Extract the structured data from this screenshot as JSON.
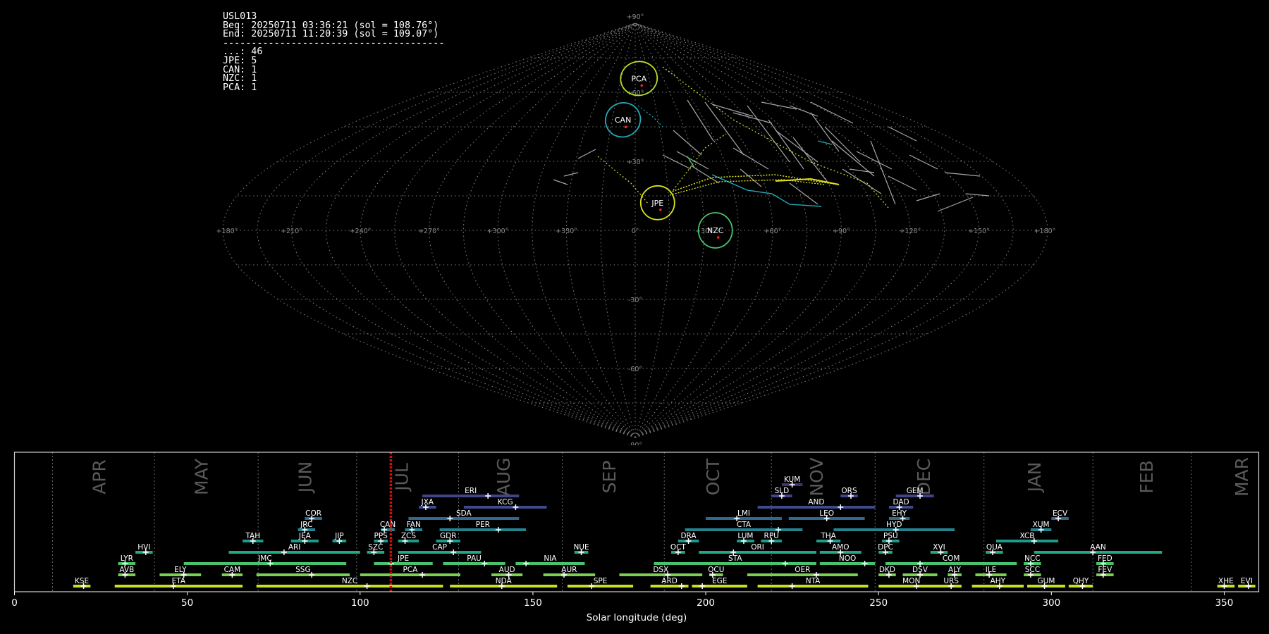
{
  "info": {
    "lines": [
      "USL013",
      "Beg: 20250711 03:36:21 (sol = 108.76°)",
      "End: 20250711 11:20:39 (sol = 109.07°)",
      "---------------------------------------",
      "...: 46",
      "JPE: 5",
      "CAN: 1",
      "NZC: 1",
      "PCA: 1"
    ]
  },
  "sky_map": {
    "projection": "sinusoidal",
    "lon_ticks": [
      "+180°",
      "+150°",
      "+120°",
      "+90°",
      "+60°",
      "+30°",
      "0°",
      "+330°",
      "+300°",
      "+270°",
      "+240°",
      "+210°",
      "+180°"
    ],
    "lat_ticks": [
      {
        "lat": 90,
        "label": "+90°"
      },
      {
        "lat": 60,
        "label": "+60°"
      },
      {
        "lat": 30,
        "label": "+30°"
      },
      {
        "lat": -30,
        "label": "-30°"
      },
      {
        "lat": -60,
        "label": "-60°"
      },
      {
        "lat": -90,
        "label": "-90°"
      }
    ],
    "radiants": [
      {
        "code": "PCA",
        "lon": -4,
        "lat": 66,
        "color": "#b5de2b"
      },
      {
        "code": "CAN",
        "lon": 8,
        "lat": 48,
        "color": "#26a8b8"
      },
      {
        "code": "JPE",
        "lon": -10,
        "lat": 12,
        "color": "#dde318"
      },
      {
        "code": "NZC",
        "lon": -35,
        "lat": 0,
        "color": "#4ac16d"
      }
    ]
  },
  "chart_data": {
    "type": "gantt",
    "xlabel": "Solar longitude (deg)",
    "xlim": [
      0,
      360
    ],
    "xticks": [
      0,
      50,
      100,
      150,
      200,
      250,
      300,
      350
    ],
    "current_sol": 108.9,
    "months": [
      {
        "label": "APR",
        "center": 24.5,
        "boundary": 11
      },
      {
        "label": "MAY",
        "center": 54,
        "boundary": 40.5
      },
      {
        "label": "JUN",
        "center": 84,
        "boundary": 70.5
      },
      {
        "label": "JUL",
        "center": 112,
        "boundary": 99
      },
      {
        "label": "AUG",
        "center": 141.5,
        "boundary": 128.5
      },
      {
        "label": "SEP",
        "center": 172,
        "boundary": 158.5
      },
      {
        "label": "OCT",
        "center": 202,
        "boundary": 188
      },
      {
        "label": "NOV",
        "center": 232,
        "boundary": 219
      },
      {
        "label": "DEC",
        "center": 263,
        "boundary": 249
      },
      {
        "label": "JAN",
        "center": 295,
        "boundary": 280.5
      },
      {
        "label": "FEB",
        "center": 327.5,
        "boundary": 312
      },
      {
        "label": "MAR",
        "center": 355,
        "boundary": 340.5
      }
    ],
    "showers": [
      {
        "code": "KUM",
        "row": 11,
        "start": 222,
        "end": 228,
        "peak": 225
      },
      {
        "code": "ERI",
        "row": 10,
        "start": 118,
        "end": 146,
        "peak": 137
      },
      {
        "code": "SLD",
        "row": 10,
        "start": 219,
        "end": 225,
        "peak": 222
      },
      {
        "code": "ORS",
        "row": 10,
        "start": 239,
        "end": 244,
        "peak": 242
      },
      {
        "code": "GEM",
        "row": 10,
        "start": 255,
        "end": 266,
        "peak": 262
      },
      {
        "code": "JXA",
        "row": 9,
        "start": 117,
        "end": 122,
        "peak": 119
      },
      {
        "code": "KCG",
        "row": 9,
        "start": 130,
        "end": 154,
        "peak": 145
      },
      {
        "code": "AND",
        "row": 9,
        "start": 215,
        "end": 249,
        "peak": 239
      },
      {
        "code": "DAD",
        "row": 9,
        "start": 253,
        "end": 260,
        "peak": 256
      },
      {
        "code": "COR",
        "row": 8,
        "start": 84,
        "end": 89,
        "peak": 86
      },
      {
        "code": "SDA",
        "row": 8,
        "start": 114,
        "end": 146,
        "peak": 126
      },
      {
        "code": "LMI",
        "row": 8,
        "start": 200,
        "end": 222,
        "peak": 209
      },
      {
        "code": "LEO",
        "row": 8,
        "start": 224,
        "end": 246,
        "peak": 235
      },
      {
        "code": "EHY",
        "row": 8,
        "start": 253,
        "end": 259,
        "peak": 257
      },
      {
        "code": "ECV",
        "row": 8,
        "start": 300,
        "end": 305,
        "peak": 302
      },
      {
        "code": "JRC",
        "row": 7,
        "start": 82,
        "end": 87,
        "peak": 84
      },
      {
        "code": "CAN",
        "row": 7,
        "start": 106,
        "end": 110,
        "peak": 107
      },
      {
        "code": "FAN",
        "row": 7,
        "start": 113,
        "end": 118,
        "peak": 115
      },
      {
        "code": "PER",
        "row": 7,
        "start": 123,
        "end": 148,
        "peak": 140
      },
      {
        "code": "CTA",
        "row": 7,
        "start": 194,
        "end": 228,
        "peak": 221
      },
      {
        "code": "HYD",
        "row": 7,
        "start": 237,
        "end": 272,
        "peak": 255
      },
      {
        "code": "XUM",
        "row": 7,
        "start": 294,
        "end": 300,
        "peak": 297
      },
      {
        "code": "TAH",
        "row": 6,
        "start": 66,
        "end": 72,
        "peak": 69
      },
      {
        "code": "JEA",
        "row": 6,
        "start": 80,
        "end": 88,
        "peak": 84
      },
      {
        "code": "JIP",
        "row": 6,
        "start": 92,
        "end": 96,
        "peak": 94
      },
      {
        "code": "PPS",
        "row": 6,
        "start": 104,
        "end": 108,
        "peak": 106
      },
      {
        "code": "ZCS",
        "row": 6,
        "start": 111,
        "end": 117,
        "peak": 113
      },
      {
        "code": "GDR",
        "row": 6,
        "start": 122,
        "end": 129,
        "peak": 126
      },
      {
        "code": "DRA",
        "row": 6,
        "start": 192,
        "end": 198,
        "peak": 195
      },
      {
        "code": "LUM",
        "row": 6,
        "start": 209,
        "end": 214,
        "peak": 211
      },
      {
        "code": "RPU",
        "row": 6,
        "start": 216,
        "end": 222,
        "peak": 219
      },
      {
        "code": "THA",
        "row": 6,
        "start": 232,
        "end": 239,
        "peak": 236
      },
      {
        "code": "PSU",
        "row": 6,
        "start": 251,
        "end": 256,
        "peak": 253
      },
      {
        "code": "XCB",
        "row": 6,
        "start": 284,
        "end": 302,
        "peak": 295
      },
      {
        "code": "HVI",
        "row": 5,
        "start": 35,
        "end": 40,
        "peak": 38
      },
      {
        "code": "ARI",
        "row": 5,
        "start": 62,
        "end": 100,
        "peak": 78
      },
      {
        "code": "SZC",
        "row": 5,
        "start": 102,
        "end": 107,
        "peak": 104
      },
      {
        "code": "CAP",
        "row": 5,
        "start": 111,
        "end": 135,
        "peak": 127
      },
      {
        "code": "NUE",
        "row": 5,
        "start": 162,
        "end": 166,
        "peak": 164
      },
      {
        "code": "OCT",
        "row": 5,
        "start": 190,
        "end": 194,
        "peak": 192
      },
      {
        "code": "ORI",
        "row": 5,
        "start": 198,
        "end": 232,
        "peak": 208
      },
      {
        "code": "AMO",
        "row": 5,
        "start": 233,
        "end": 245,
        "peak": 239
      },
      {
        "code": "DPC",
        "row": 5,
        "start": 250,
        "end": 254,
        "peak": 252
      },
      {
        "code": "XVI",
        "row": 5,
        "start": 265,
        "end": 270,
        "peak": 268
      },
      {
        "code": "QUA",
        "row": 5,
        "start": 281,
        "end": 286,
        "peak": 283
      },
      {
        "code": "AAN",
        "row": 5,
        "start": 295,
        "end": 332,
        "peak": 312
      },
      {
        "code": "LYR",
        "row": 4,
        "start": 30,
        "end": 35,
        "peak": 32
      },
      {
        "code": "JMC",
        "row": 4,
        "start": 49,
        "end": 96,
        "peak": 74
      },
      {
        "code": "JPE",
        "row": 4,
        "start": 104,
        "end": 121,
        "peak": 109
      },
      {
        "code": "PAU",
        "row": 4,
        "start": 124,
        "end": 142,
        "peak": 136
      },
      {
        "code": "NIA",
        "row": 4,
        "start": 145,
        "end": 165,
        "peak": 148
      },
      {
        "code": "STA",
        "row": 4,
        "start": 185,
        "end": 232,
        "peak": 223
      },
      {
        "code": "NOO",
        "row": 4,
        "start": 233,
        "end": 249,
        "peak": 246
      },
      {
        "code": "COM",
        "row": 4,
        "start": 252,
        "end": 290,
        "peak": 262
      },
      {
        "code": "NCC",
        "row": 4,
        "start": 292,
        "end": 297,
        "peak": 294
      },
      {
        "code": "FED",
        "row": 4,
        "start": 313,
        "end": 318,
        "peak": 315
      },
      {
        "code": "AVB",
        "row": 3,
        "start": 30,
        "end": 35,
        "peak": 32
      },
      {
        "code": "ELY",
        "row": 3,
        "start": 42,
        "end": 54,
        "peak": 49
      },
      {
        "code": "CAM",
        "row": 3,
        "start": 60,
        "end": 66,
        "peak": 63
      },
      {
        "code": "SSG",
        "row": 3,
        "start": 70,
        "end": 97,
        "peak": 86
      },
      {
        "code": "PCA",
        "row": 3,
        "start": 100,
        "end": 129,
        "peak": 118
      },
      {
        "code": "AUD",
        "row": 3,
        "start": 138,
        "end": 147,
        "peak": 143
      },
      {
        "code": "AUR",
        "row": 3,
        "start": 153,
        "end": 168,
        "peak": 159
      },
      {
        "code": "DSX",
        "row": 3,
        "start": 175,
        "end": 199,
        "peak": 189
      },
      {
        "code": "OCU",
        "row": 3,
        "start": 201,
        "end": 205,
        "peak": 202
      },
      {
        "code": "OER",
        "row": 3,
        "start": 212,
        "end": 244,
        "peak": 232
      },
      {
        "code": "DKD",
        "row": 3,
        "start": 250,
        "end": 255,
        "peak": 253
      },
      {
        "code": "DSV",
        "row": 3,
        "start": 257,
        "end": 267,
        "peak": 262
      },
      {
        "code": "ALY",
        "row": 3,
        "start": 270,
        "end": 274,
        "peak": 272
      },
      {
        "code": "ILE",
        "row": 3,
        "start": 278,
        "end": 287,
        "peak": 282
      },
      {
        "code": "SCC",
        "row": 3,
        "start": 292,
        "end": 297,
        "peak": 294
      },
      {
        "code": "FEV",
        "row": 3,
        "start": 313,
        "end": 318,
        "peak": 315
      },
      {
        "code": "KSE",
        "row": 2,
        "start": 17,
        "end": 22,
        "peak": 20
      },
      {
        "code": "ETA",
        "row": 2,
        "start": 29,
        "end": 66,
        "peak": 46
      },
      {
        "code": "NZC",
        "row": 2,
        "start": 70,
        "end": 124,
        "peak": 102
      },
      {
        "code": "NDA",
        "row": 2,
        "start": 126,
        "end": 157,
        "peak": 141
      },
      {
        "code": "SPE",
        "row": 2,
        "start": 160,
        "end": 179,
        "peak": 167
      },
      {
        "code": "ARD",
        "row": 2,
        "start": 184,
        "end": 195,
        "peak": 193
      },
      {
        "code": "EGE",
        "row": 2,
        "start": 196,
        "end": 212,
        "peak": 199
      },
      {
        "code": "NTA",
        "row": 2,
        "start": 215,
        "end": 247,
        "peak": 225
      },
      {
        "code": "MON",
        "row": 2,
        "start": 250,
        "end": 269,
        "peak": 261
      },
      {
        "code": "URS",
        "row": 2,
        "start": 268,
        "end": 274,
        "peak": 271
      },
      {
        "code": "AHY",
        "row": 2,
        "start": 277,
        "end": 292,
        "peak": 285
      },
      {
        "code": "GUM",
        "row": 2,
        "start": 293,
        "end": 304,
        "peak": 298
      },
      {
        "code": "QHY",
        "row": 2,
        "start": 305,
        "end": 312,
        "peak": 309
      },
      {
        "code": "XHE",
        "row": 2,
        "start": 348,
        "end": 353,
        "peak": 350
      },
      {
        "code": "EVI",
        "row": 2,
        "start": 354,
        "end": 359,
        "peak": 357
      }
    ]
  }
}
